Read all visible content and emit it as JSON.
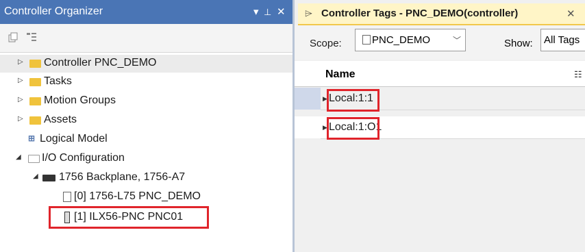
{
  "left_panel": {
    "title": "Controller Organizer",
    "controls": {
      "dropdown": "▾",
      "pin": "⊥",
      "close": "✕"
    },
    "toolbar_icons": [
      "collapse-all-icon",
      "expand-all-icon"
    ],
    "tree": [
      {
        "label": "Controller PNC_DEMO",
        "icon": "folder-icon"
      },
      {
        "label": "Tasks",
        "icon": "folder-icon"
      },
      {
        "label": "Motion Groups",
        "icon": "folder-icon"
      },
      {
        "label": "Assets",
        "icon": "folder-icon"
      },
      {
        "label": "Logical Model",
        "icon": "logical-model-icon"
      },
      {
        "label": "I/O Configuration",
        "icon": "open-folder-icon"
      },
      {
        "label": "1756 Backplane, 1756-A7",
        "icon": "backplane-icon"
      },
      {
        "label": "[0] 1756-L75 PNC_DEMO",
        "icon": "controller-icon"
      },
      {
        "label": "[1] ILX56-PNC PNC01",
        "icon": "module-icon"
      }
    ]
  },
  "right_panel": {
    "tab": {
      "title": "Controller Tags - PNC_DEMO(controller)",
      "close": "✕"
    },
    "scope": {
      "label": "Scope:",
      "value": "PNC_DEMO"
    },
    "show": {
      "label": "Show:",
      "value": "All Tags"
    },
    "grid": {
      "header": "Name",
      "rows": [
        {
          "prefix": "Local:1:",
          "suffix": "1"
        },
        {
          "prefix": "Local:1:",
          "suffix": "O1"
        }
      ]
    }
  },
  "colors": {
    "title_bar": "#4a75b5",
    "tab_active": "#fff5c7",
    "highlight_box": "#e0242b"
  }
}
